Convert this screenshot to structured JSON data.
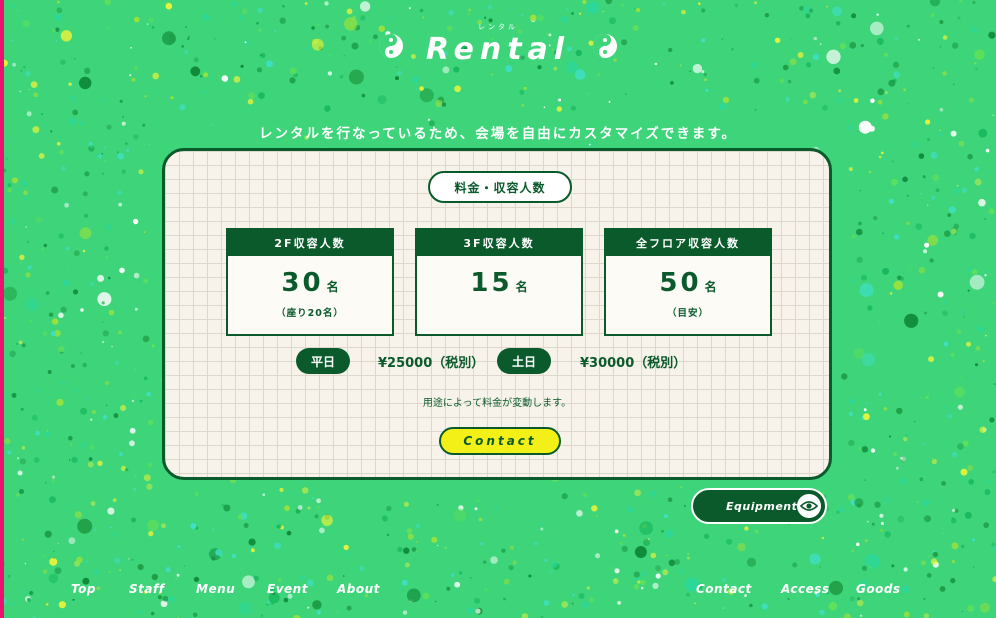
{
  "header": {
    "ruby": "レンタル",
    "title": "Rental"
  },
  "tagline": "レンタルを行なっているため、会場を自由にカスタマイズできます。",
  "card": {
    "section_title": "料金・収容人数",
    "capacity": [
      {
        "label": "2F収容人数",
        "value": "30",
        "unit": "名",
        "note": "（座り20名）"
      },
      {
        "label": "3F収容人数",
        "value": "15",
        "unit": "名",
        "note": ""
      },
      {
        "label": "全フロア収容人数",
        "value": "50",
        "unit": "名",
        "note": "（目安）"
      }
    ],
    "prices": [
      {
        "label": "平日",
        "price": "¥25000（税別）"
      },
      {
        "label": "土日",
        "price": "¥30000（税別）"
      }
    ],
    "usage_note": "用途によって料金が変動します。",
    "contact_label": "Contact"
  },
  "equipment_button": {
    "label": "Equipment",
    "icon": "eye-icon"
  },
  "nav_left": [
    "Top",
    "Staff",
    "Menu",
    "Event",
    "About"
  ],
  "nav_right": [
    "Contact",
    "Access",
    "Goods"
  ],
  "colors": {
    "background": "#3dd47a",
    "dark_green": "#0a5a2b",
    "accent_yellow": "#f2f016",
    "card_bg": "#f8f3ea",
    "edge_pink": "#e9136f"
  }
}
